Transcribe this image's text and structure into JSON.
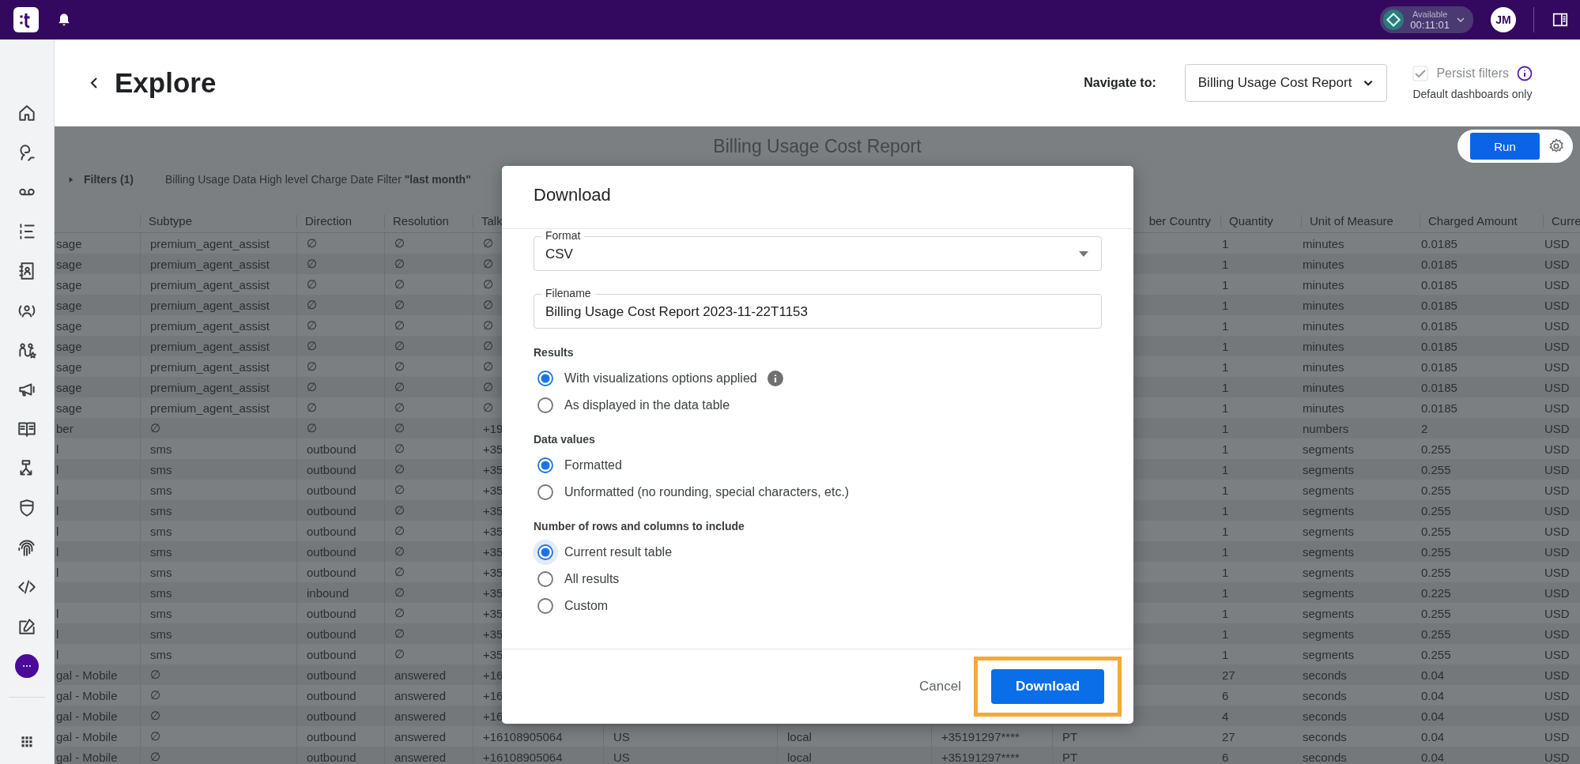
{
  "top_bar": {
    "status": {
      "label": "Available",
      "timer": "00:11:01"
    },
    "avatar_initials": "JM"
  },
  "header": {
    "title": "Explore",
    "navigate_label": "Navigate to:",
    "dashboard_select": "Billing Usage Cost Report",
    "persist_filters": {
      "label": "Persist filters",
      "checked": true,
      "disabled": true,
      "hint": "Default dashboards only"
    }
  },
  "report": {
    "title": "Billing Usage Cost Report",
    "run_button": "Run",
    "filters": {
      "label": "Filters (1)",
      "expanded": false,
      "summary": "Billing Usage Data High level Charge Date Filter **\"last month\"**"
    }
  },
  "table": {
    "left_headers": [
      "Subtype",
      "Direction",
      "Resolution",
      "Talk"
    ],
    "right_headers": [
      "ber Country",
      "Quantity",
      "Unit of Measure",
      "Charged Amount",
      "Curre"
    ],
    "rows": [
      {
        "column_1": "sage",
        "cells": [
          "premium_agent_assist",
          "∅",
          "∅",
          "∅",
          "1",
          "minutes",
          "0.0185",
          "USD"
        ]
      },
      {
        "column_1": "sage",
        "cells": [
          "premium_agent_assist",
          "∅",
          "∅",
          "∅",
          "1",
          "minutes",
          "0.0185",
          "USD"
        ]
      },
      {
        "column_1": "sage",
        "cells": [
          "premium_agent_assist",
          "∅",
          "∅",
          "∅",
          "1",
          "minutes",
          "0.0185",
          "USD"
        ]
      },
      {
        "column_1": "sage",
        "cells": [
          "premium_agent_assist",
          "∅",
          "∅",
          "∅",
          "1",
          "minutes",
          "0.0185",
          "USD"
        ]
      },
      {
        "column_1": "sage",
        "cells": [
          "premium_agent_assist",
          "∅",
          "∅",
          "∅",
          "1",
          "minutes",
          "0.0185",
          "USD"
        ]
      },
      {
        "column_1": "sage",
        "cells": [
          "premium_agent_assist",
          "∅",
          "∅",
          "∅",
          "1",
          "minutes",
          "0.0185",
          "USD"
        ]
      },
      {
        "column_1": "sage",
        "cells": [
          "premium_agent_assist",
          "∅",
          "∅",
          "∅",
          "1",
          "minutes",
          "0.0185",
          "USD"
        ]
      },
      {
        "column_1": "sage",
        "cells": [
          "premium_agent_assist",
          "∅",
          "∅",
          "∅",
          "1",
          "minutes",
          "0.0185",
          "USD"
        ]
      },
      {
        "column_1": "sage",
        "cells": [
          "premium_agent_assist",
          "∅",
          "∅",
          "∅",
          "1",
          "minutes",
          "0.0185",
          "USD"
        ]
      },
      {
        "column_1": "ber",
        "cells": [
          "∅",
          "∅",
          "∅",
          "+19",
          "1",
          "numbers",
          "2",
          "USD"
        ]
      },
      {
        "column_1": "l",
        "cells": [
          "sms",
          "outbound",
          "∅",
          "+35",
          "1",
          "segments",
          "0.255",
          "USD"
        ]
      },
      {
        "column_1": "l",
        "cells": [
          "sms",
          "outbound",
          "∅",
          "+35",
          "1",
          "segments",
          "0.255",
          "USD"
        ]
      },
      {
        "column_1": "l",
        "cells": [
          "sms",
          "outbound",
          "∅",
          "+35",
          "1",
          "segments",
          "0.255",
          "USD"
        ]
      },
      {
        "column_1": "l",
        "cells": [
          "sms",
          "outbound",
          "∅",
          "+35",
          "1",
          "segments",
          "0.255",
          "USD"
        ]
      },
      {
        "column_1": "l",
        "cells": [
          "sms",
          "outbound",
          "∅",
          "+35",
          "1",
          "segments",
          "0.255",
          "USD"
        ]
      },
      {
        "column_1": "l",
        "cells": [
          "sms",
          "outbound",
          "∅",
          "+35",
          "1",
          "segments",
          "0.255",
          "USD"
        ]
      },
      {
        "column_1": "l",
        "cells": [
          "sms",
          "outbound",
          "∅",
          "+35",
          "1",
          "segments",
          "0.255",
          "USD"
        ]
      },
      {
        "cells": [
          "sms",
          "inbound",
          "∅",
          "+35",
          "1",
          "segments",
          "0.225",
          "USD"
        ]
      },
      {
        "column_1": "l",
        "cells": [
          "sms",
          "outbound",
          "∅",
          "+35",
          "1",
          "segments",
          "0.255",
          "USD"
        ]
      },
      {
        "column_1": "l",
        "cells": [
          "sms",
          "outbound",
          "∅",
          "+35",
          "1",
          "segments",
          "0.255",
          "USD"
        ]
      },
      {
        "column_1": "l",
        "cells": [
          "sms",
          "outbound",
          "∅",
          "+35",
          "1",
          "segments",
          "0.255",
          "USD"
        ]
      },
      {
        "column_1": "gal - Mobile",
        "cells": [
          "∅",
          "outbound",
          "answered",
          "+16",
          "27",
          "seconds",
          "0.04",
          "USD"
        ]
      },
      {
        "column_1": "gal - Mobile",
        "cells": [
          "∅",
          "outbound",
          "answered",
          "+16",
          "6",
          "seconds",
          "0.04",
          "USD"
        ]
      },
      {
        "column_1": "gal - Mobile",
        "cells": [
          "∅",
          "outbound",
          "answered",
          "+16",
          "4",
          "seconds",
          "0.04",
          "USD"
        ]
      },
      {
        "column_1": "gal - Mobile",
        "cells": [
          "∅",
          "outbound",
          "answered",
          "+16108905064",
          "27",
          "seconds",
          "0.04",
          "USD"
        ],
        "middle_cells": [
          "US",
          "local",
          "+35191297****",
          "PT"
        ]
      },
      {
        "column_1": "gal - Mobile",
        "cells": [
          "∅",
          "outbound",
          "answered",
          "+16108905064",
          "6",
          "seconds",
          "0.04",
          "USD"
        ],
        "middle_cells": [
          "US",
          "local",
          "+35191297****",
          "PT"
        ]
      }
    ]
  },
  "dialog": {
    "title": "Download",
    "format": {
      "label": "Format",
      "value": "CSV"
    },
    "filename": {
      "label": "Filename",
      "value": "Billing Usage Cost Report 2023-11-22T1153"
    },
    "groups": [
      {
        "title": "Results",
        "options": [
          {
            "label": "With visualizations options applied",
            "selected": true,
            "focused": false,
            "info": true
          },
          {
            "label": "As displayed in the data table",
            "selected": false,
            "focused": false,
            "info": false
          }
        ]
      },
      {
        "title": "Data values",
        "options": [
          {
            "label": "Formatted",
            "selected": true,
            "focused": false,
            "info": false
          },
          {
            "label": "Unformatted (no rounding, special characters, etc.)",
            "selected": false,
            "focused": false,
            "info": false
          }
        ]
      },
      {
        "title": "Number of rows and columns to include",
        "options": [
          {
            "label": "Current result table",
            "selected": true,
            "focused": true,
            "info": false
          },
          {
            "label": "All results",
            "selected": false,
            "focused": false,
            "info": false
          },
          {
            "label": "Custom",
            "selected": false,
            "focused": false,
            "info": false
          }
        ]
      }
    ],
    "cancel_button": "Cancel",
    "download_button": "Download",
    "download_highlighted": true
  }
}
